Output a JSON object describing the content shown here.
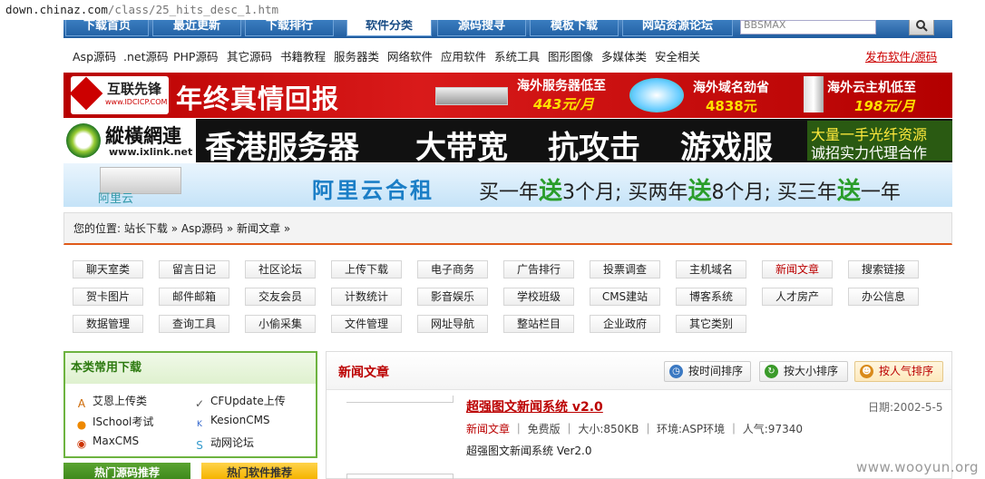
{
  "address_bar": {
    "host": "down.chinaz.com",
    "path": "/class/25_hits_desc_1.htm"
  },
  "top_nav": {
    "tabs": [
      "下载首页",
      "最近更新",
      "下载排行",
      "软件分类",
      "源码搜寻",
      "模板下载",
      "网站资源论坛"
    ],
    "active_index": 3,
    "search_value": "BBSMAX"
  },
  "sub_nav": {
    "items": [
      "Asp源码",
      ".net源码",
      "PHP源码",
      "其它源码",
      "书籍教程",
      "服务器类",
      "网络软件",
      "应用软件",
      "系统工具",
      "图形图像",
      "多媒体类",
      "安全相关"
    ],
    "publish": "发布软件/源码"
  },
  "banners": {
    "b1": {
      "brand": "互联先锋",
      "brand_url": "www.IDCICP.COM",
      "slogan": "年终真情回报",
      "offers": [
        {
          "label": "海外服务器低至",
          "price": "443元/月"
        },
        {
          "label": "海外域名劲省",
          "price": "4838元"
        },
        {
          "label": "海外云主机低至",
          "price": "198元/月"
        }
      ]
    },
    "b2": {
      "brand": "縱橫網連",
      "brand_url": "www.ixlink.net",
      "words": [
        "香港服务器",
        "大带宽",
        "抗攻击",
        "游戏服"
      ],
      "right1": "大量一手光纤资源",
      "right2": "诚招实力代理合作"
    },
    "b3": {
      "brand": "阿里云",
      "title": "阿里云合租",
      "p1": "买一年",
      "s1": "送",
      "p2": "3个月; 买两年",
      "s2": "送",
      "p3": "8个月; 买三年",
      "s3": "送",
      "p4": "一年"
    }
  },
  "breadcrumb": {
    "prefix": "您的位置:",
    "items": [
      "站长下载",
      "Asp源码",
      "新闻文章"
    ],
    "sep": "»"
  },
  "categories": [
    "聊天室类",
    "留言日记",
    "社区论坛",
    "上传下载",
    "电子商务",
    "广告排行",
    "投票调查",
    "主机域名",
    "新闻文章",
    "搜索链接",
    "贺卡图片",
    "邮件邮箱",
    "交友会员",
    "计数统计",
    "影音娱乐",
    "学校班级",
    "CMS建站",
    "博客系统",
    "人才房产",
    "办公信息",
    "数据管理",
    "查询工具",
    "小偷采集",
    "文件管理",
    "网址导航",
    "整站栏目",
    "企业政府",
    "其它类别"
  ],
  "categories_highlight": "新闻文章",
  "left_panel": {
    "title": "本类常用下载",
    "downloads": [
      {
        "name": "艾恩上传类",
        "icon": "upload-icon"
      },
      {
        "name": "CFUpdate上传",
        "icon": "cfupdate-icon"
      },
      {
        "name": "ISchool考试",
        "icon": "school-icon"
      },
      {
        "name": "KesionCMS",
        "icon": "kesion-icon"
      },
      {
        "name": "MaxCMS",
        "icon": "maxcms-icon"
      },
      {
        "name": "动网论坛",
        "icon": "dvbbs-icon"
      }
    ],
    "tab_a": "热门源码推荐",
    "tab_b": "热门软件推荐"
  },
  "main_panel": {
    "title": "新闻文章",
    "sort_buttons": [
      {
        "label": "按时间排序",
        "icon": "clock-icon"
      },
      {
        "label": "按大小排序",
        "icon": "size-icon"
      },
      {
        "label": "按人气排序",
        "icon": "people-icon"
      }
    ],
    "active_sort": 2,
    "item": {
      "name": "超强图文新闻系统 v2.0",
      "date": "日期:2002-5-5",
      "category": "新闻文章",
      "license": "免费版",
      "size": "大小:850KB",
      "env": "环境:ASP环境",
      "popularity": "人气:97340",
      "desc": "超强图文新闻系统 Ver2.0"
    }
  },
  "watermark": "www.wooyun.org",
  "colors": {
    "nav_blue": "#2463a6",
    "accent_red": "#bb0000",
    "orange_rule": "#e05a1a",
    "green_border": "#6db33f"
  }
}
